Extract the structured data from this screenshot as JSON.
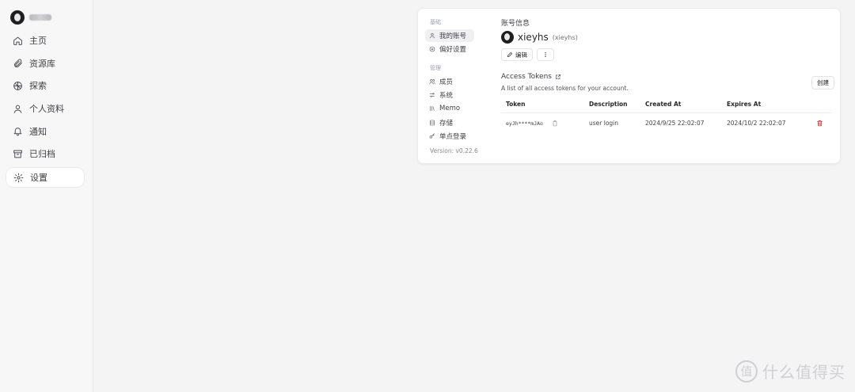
{
  "sidebar": {
    "username_blurred": true,
    "items": [
      {
        "label": "主页",
        "icon": "home-icon",
        "active": false
      },
      {
        "label": "资源库",
        "icon": "paperclip-icon",
        "active": false
      },
      {
        "label": "探索",
        "icon": "compass-icon",
        "active": false
      },
      {
        "label": "个人资料",
        "icon": "user-icon",
        "active": false
      },
      {
        "label": "通知",
        "icon": "bell-icon",
        "active": false
      },
      {
        "label": "已归档",
        "icon": "archive-icon",
        "active": false
      },
      {
        "label": "设置",
        "icon": "gear-icon",
        "active": true
      }
    ]
  },
  "settings_menu": {
    "basic_label": "基础",
    "basic_items": [
      {
        "label": "我的账号",
        "icon": "user-icon",
        "active": true
      },
      {
        "label": "偏好设置",
        "icon": "settings-icon",
        "active": false
      }
    ],
    "admin_label": "管理",
    "admin_items": [
      {
        "label": "成员",
        "icon": "users-icon"
      },
      {
        "label": "系统",
        "icon": "sliders-icon"
      },
      {
        "label": "Memo",
        "icon": "library-icon"
      },
      {
        "label": "存储",
        "icon": "database-icon"
      },
      {
        "label": "单点登录",
        "icon": "key-icon"
      }
    ],
    "version": "Version: v0.22.6"
  },
  "account": {
    "title": "账号信息",
    "display_name": "xieyhs",
    "handle": "(xieyhs)",
    "edit_label": "编辑",
    "more_icon": "more-vertical-icon"
  },
  "tokens": {
    "title": "Access Tokens",
    "description": "A list of all access tokens for your account.",
    "create_label": "创建",
    "columns": [
      "Token",
      "Description",
      "Created At",
      "Expires At"
    ],
    "rows": [
      {
        "token": "eyJh****mJAo",
        "description": "user login",
        "created": "2024/9/25 22:02:07",
        "expires": "2024/10/2 22:02:07"
      }
    ]
  },
  "watermark": {
    "text": "什么值得买",
    "logo_char": "值"
  }
}
